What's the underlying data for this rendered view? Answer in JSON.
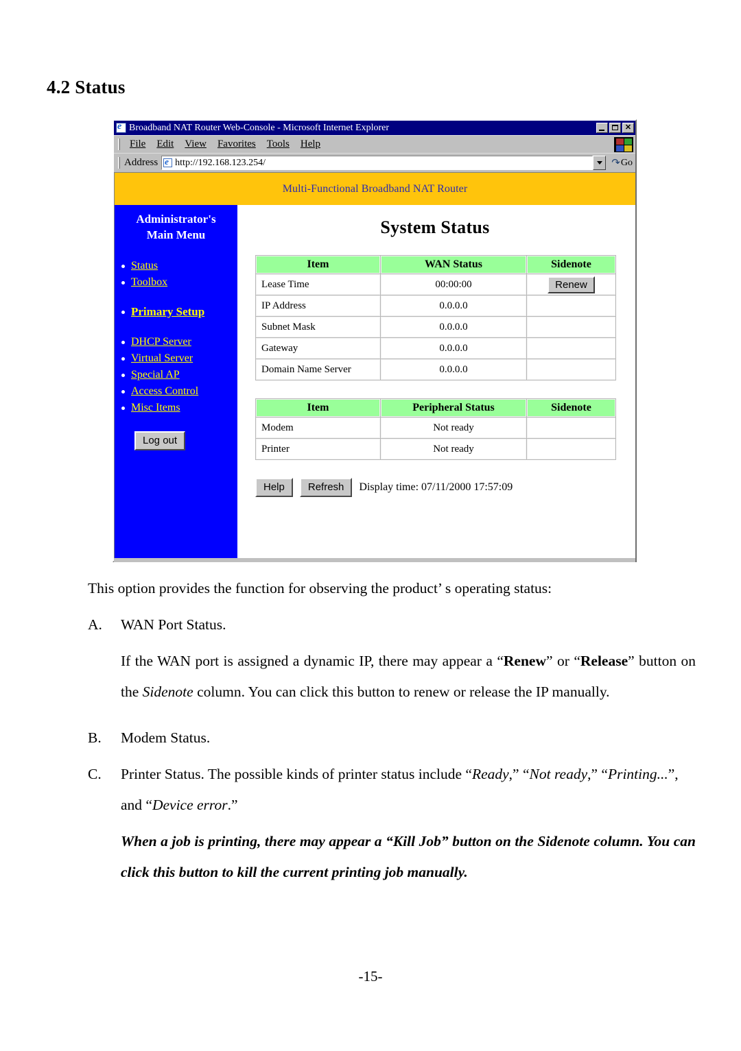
{
  "document": {
    "heading": "4.2 Status",
    "page_number": "-15-"
  },
  "browser": {
    "title": "Broadband NAT Router Web-Console - Microsoft Internet Explorer",
    "window_buttons": {
      "minimize": "minimize",
      "maximize": "maximize",
      "close": "✕"
    },
    "menu": [
      "File",
      "Edit",
      "View",
      "Favorites",
      "Tools",
      "Help"
    ],
    "address": {
      "label": "Address",
      "url": "http://192.168.123.254/",
      "go_label": "Go"
    }
  },
  "router_page": {
    "banner": "Multi-Functional Broadband NAT Router",
    "sidebar": {
      "title_line1": "Administrator's",
      "title_line2": "Main Menu",
      "group1": [
        {
          "label": "Status",
          "bold": false
        },
        {
          "label": "Toolbox",
          "bold": false
        }
      ],
      "group2": [
        {
          "label": "Primary Setup",
          "bold": true
        }
      ],
      "group3": [
        {
          "label": "DHCP Server",
          "bold": false
        },
        {
          "label": "Virtual Server",
          "bold": false
        },
        {
          "label": "Special AP",
          "bold": false
        },
        {
          "label": "Access Control",
          "bold": false
        },
        {
          "label": "Misc Items",
          "bold": false
        }
      ],
      "logout_label": "Log out"
    },
    "content_title": "System Status",
    "wan_table": {
      "headers": [
        "Item",
        "WAN Status",
        "Sidenote"
      ],
      "rows": [
        {
          "item": "Lease Time",
          "value": "00:00:00",
          "note": "Renew",
          "note_is_button": true
        },
        {
          "item": "IP Address",
          "value": "0.0.0.0",
          "note": "",
          "note_is_button": false
        },
        {
          "item": "Subnet Mask",
          "value": "0.0.0.0",
          "note": "",
          "note_is_button": false
        },
        {
          "item": "Gateway",
          "value": "0.0.0.0",
          "note": "",
          "note_is_button": false
        },
        {
          "item": "Domain Name Server",
          "value": "0.0.0.0",
          "note": "",
          "note_is_button": false
        }
      ]
    },
    "peripheral_table": {
      "headers": [
        "Item",
        "Peripheral Status",
        "Sidenote"
      ],
      "rows": [
        {
          "item": "Modem",
          "value": "Not ready",
          "note": ""
        },
        {
          "item": "Printer",
          "value": "Not ready",
          "note": ""
        }
      ]
    },
    "actions": {
      "help_label": "Help",
      "refresh_label": "Refresh",
      "display_time": "Display time: 07/11/2000 17:57:09"
    }
  },
  "prose": {
    "intro": "This option provides the function for observing the product’ s operating status:",
    "item_a": {
      "marker": "A.",
      "text": "WAN Port Status."
    },
    "item_a_detail": {
      "part1": "If the WAN port is assigned a dynamic IP, there may appear a “",
      "renew": "Renew",
      "part2": "” or “",
      "release": "Release",
      "part3": "” button on the ",
      "sidenote": "Sidenote",
      "part4": " column. You can click this button to renew or release the IP manually."
    },
    "item_b": {
      "marker": "B.",
      "text": "Modem Status."
    },
    "item_c": {
      "marker": "C.",
      "part1": "Printer Status. The possible kinds of printer status include “",
      "ready": "Ready",
      "part2": ",” “",
      "not_ready": "Not ready",
      "part3": ",” “",
      "printing": "Printing...",
      "part4": "”, and “",
      "device_error": "Device error",
      "part5": ".”"
    },
    "note": {
      "part1": "When a job is printing, there may appear a “",
      "kill_job": "Kill Job",
      "part2": "” button on the Sidenote column. You can click this button to kill the current printing job manually."
    }
  },
  "colors": {
    "sidebar_bg": "#0000FF",
    "sidebar_link": "#FFFF00",
    "banner_bg": "#FFC40C",
    "banner_text": "#2B2BAE",
    "table_header_bg": "#99FF99",
    "titlebar_bg": "#000080"
  }
}
